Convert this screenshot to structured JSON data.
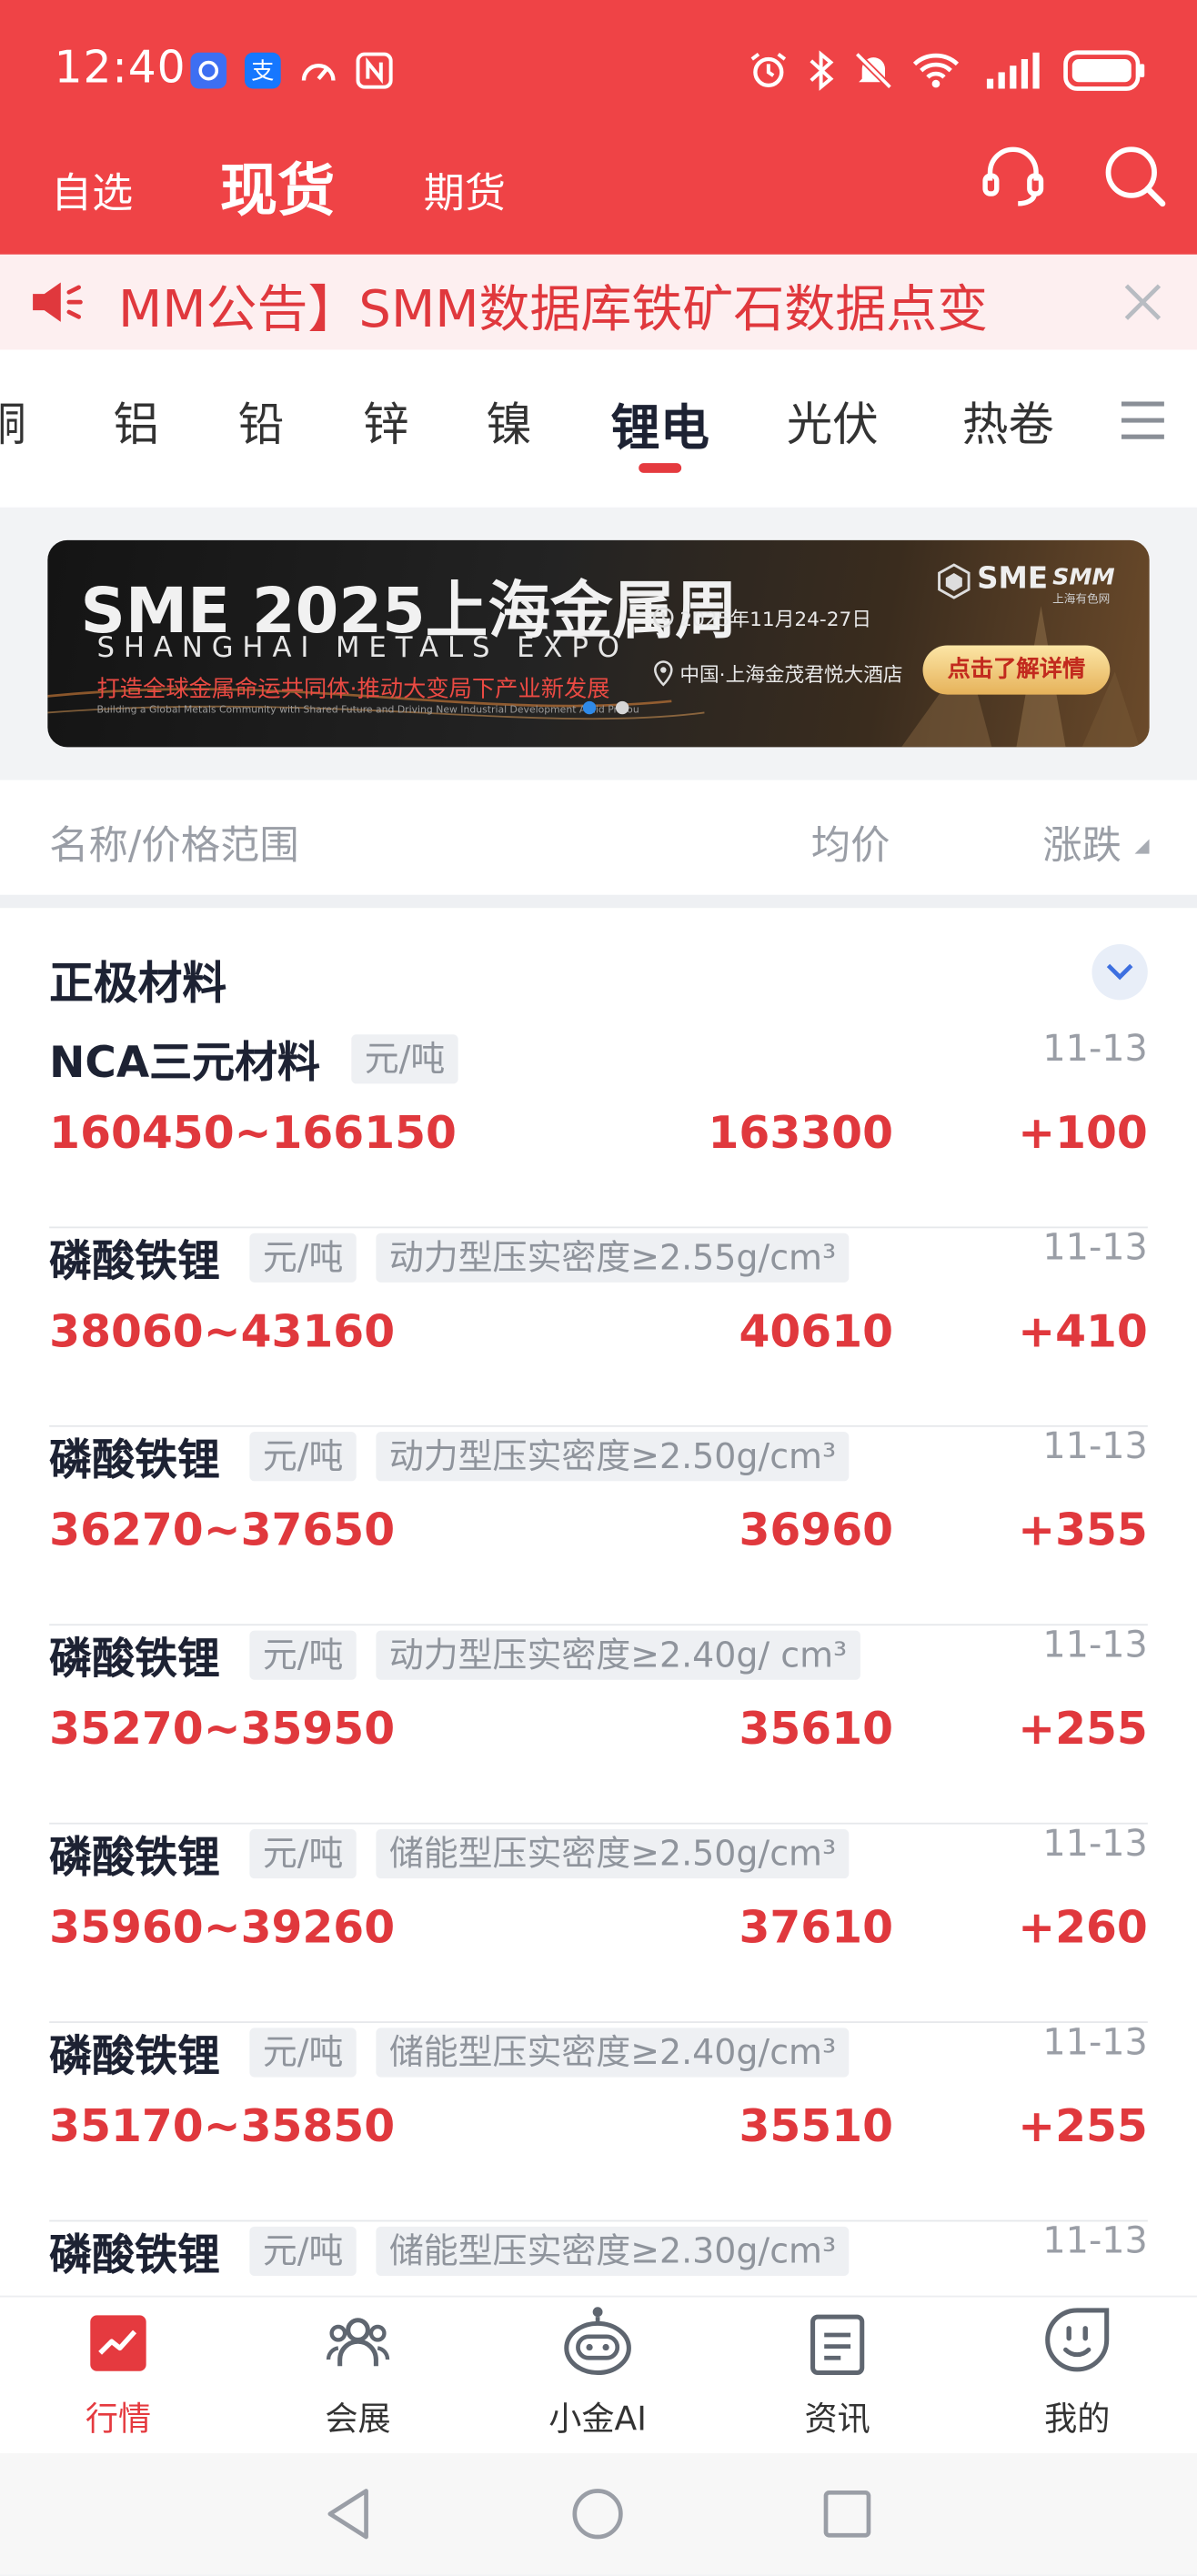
{
  "status_bar": {
    "time": "12:40"
  },
  "top_tabs": [
    {
      "label": "自选",
      "active": false
    },
    {
      "label": "现货",
      "active": true
    },
    {
      "label": "期货",
      "active": false
    }
  ],
  "header_icons": [
    "customer-service-icon",
    "search-icon"
  ],
  "notice": {
    "text": "MM公告】SMM数据库铁矿石数据点变"
  },
  "categories": [
    {
      "label": "铜",
      "active": false
    },
    {
      "label": "铝",
      "active": false
    },
    {
      "label": "铅",
      "active": false
    },
    {
      "label": "锌",
      "active": false
    },
    {
      "label": "镍",
      "active": false
    },
    {
      "label": "锂电",
      "active": true
    },
    {
      "label": "光伏",
      "active": false
    },
    {
      "label": "热卷",
      "active": false
    }
  ],
  "banner": {
    "title": "SME 2025上海金属周",
    "subtitle": "SHANGHAI METALS EXPO",
    "slogan": "打造全球金属命运共同体·推动大变局下产业新发展",
    "tagline": "Building a Global Metals Community with Shared Future and Driving New Industrial Development Amid Profound Changes",
    "date": "2025年11月24-27日",
    "venue": "中国·上海金茂君悦大酒店",
    "brand": "SME",
    "brand_sub": "上海有色网",
    "cta": "点击了解详情"
  },
  "table_header": {
    "name": "名称/价格范围",
    "avg": "均价",
    "change": "涨跌"
  },
  "section": {
    "title": "正极材料"
  },
  "rows": [
    {
      "name": "NCA三元材料",
      "unit": "元/吨",
      "spec": "",
      "date": "11-13",
      "range": "160450~166150",
      "avg": "163300",
      "change": "+100"
    },
    {
      "name": "磷酸铁锂",
      "unit": "元/吨",
      "spec": "动力型压实密度≥2.55g/cm³",
      "date": "11-13",
      "range": "38060~43160",
      "avg": "40610",
      "change": "+410"
    },
    {
      "name": "磷酸铁锂",
      "unit": "元/吨",
      "spec": "动力型压实密度≥2.50g/cm³",
      "date": "11-13",
      "range": "36270~37650",
      "avg": "36960",
      "change": "+355"
    },
    {
      "name": "磷酸铁锂",
      "unit": "元/吨",
      "spec": "动力型压实密度≥2.40g/ cm³",
      "date": "11-13",
      "range": "35270~35950",
      "avg": "35610",
      "change": "+255"
    },
    {
      "name": "磷酸铁锂",
      "unit": "元/吨",
      "spec": "储能型压实密度≥2.50g/cm³",
      "date": "11-13",
      "range": "35960~39260",
      "avg": "37610",
      "change": "+260"
    },
    {
      "name": "磷酸铁锂",
      "unit": "元/吨",
      "spec": "储能型压实密度≥2.40g/cm³",
      "date": "11-13",
      "range": "35170~35850",
      "avg": "35510",
      "change": "+255"
    },
    {
      "name": "磷酸铁锂",
      "unit": "元/吨",
      "spec": "储能型压实密度≥2.30g/cm³",
      "date": "11-13",
      "range": "",
      "avg": "",
      "change": ""
    }
  ],
  "bottom_nav": [
    {
      "label": "行情",
      "icon": "market-chart-icon",
      "active": true
    },
    {
      "label": "会展",
      "icon": "people-icon",
      "active": false
    },
    {
      "label": "小金AI",
      "icon": "robot-icon",
      "active": false
    },
    {
      "label": "资讯",
      "icon": "document-icon",
      "active": false
    },
    {
      "label": "我的",
      "icon": "smiley-profile-icon",
      "active": false
    }
  ],
  "colors": {
    "brand_red": "#ef4346",
    "price_red": "#e0383d",
    "text_dark": "#1d2233",
    "muted": "#9a9ea6"
  }
}
